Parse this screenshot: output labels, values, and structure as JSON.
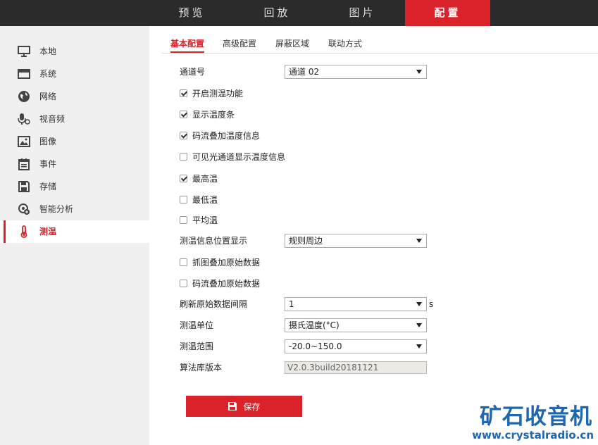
{
  "topnav": [
    {
      "label": "预览"
    },
    {
      "label": "回放"
    },
    {
      "label": "图片"
    },
    {
      "label": "配置"
    }
  ],
  "sidebar": {
    "items": [
      {
        "label": "本地",
        "icon": "monitor-icon"
      },
      {
        "label": "系统",
        "icon": "window-icon"
      },
      {
        "label": "网络",
        "icon": "globe-icon"
      },
      {
        "label": "视音频",
        "icon": "microphone-icon"
      },
      {
        "label": "图像",
        "icon": "image-icon"
      },
      {
        "label": "事件",
        "icon": "calendar-icon"
      },
      {
        "label": "存储",
        "icon": "floppy-icon"
      },
      {
        "label": "智能分析",
        "icon": "analysis-icon"
      },
      {
        "label": "测温",
        "icon": "thermometer-icon"
      }
    ],
    "active": "测温"
  },
  "subtabs": [
    "基本配置",
    "高级配置",
    "屏蔽区域",
    "联动方式"
  ],
  "form": {
    "channel": {
      "label": "通道号",
      "value": "通道 02"
    },
    "checks": [
      {
        "label": "开启测温功能",
        "checked": true
      },
      {
        "label": "显示温度条",
        "checked": true
      },
      {
        "label": "码流叠加温度信息",
        "checked": true
      },
      {
        "label": "可见光通道显示温度信息",
        "checked": false
      },
      {
        "label": "最高温",
        "checked": true
      },
      {
        "label": "最低温",
        "checked": false
      },
      {
        "label": "平均温",
        "checked": false
      }
    ],
    "info_position": {
      "label": "测温信息位置显示",
      "value": "规则周边"
    },
    "checks2": [
      {
        "label": "抓图叠加原始数据",
        "checked": false
      },
      {
        "label": "码流叠加原始数据",
        "checked": false
      }
    ],
    "refresh": {
      "label": "刷新原始数据间隔",
      "value": "1",
      "unit": "s"
    },
    "temp_unit": {
      "label": "测温单位",
      "value": "摄氏温度(°C)"
    },
    "temp_range": {
      "label": "测温范围",
      "value": "-20.0~150.0"
    },
    "algo_version": {
      "label": "算法库版本",
      "value": "V2.0.3build20181121"
    }
  },
  "save_label": "保存",
  "watermark": {
    "title": "矿石收音机",
    "url": "www.crystalradio.cn"
  },
  "colors": {
    "accent": "#d9222a",
    "topbar": "#2b2b2b",
    "sidebar": "#f0f0f0",
    "watermark": "#1f66b0"
  }
}
